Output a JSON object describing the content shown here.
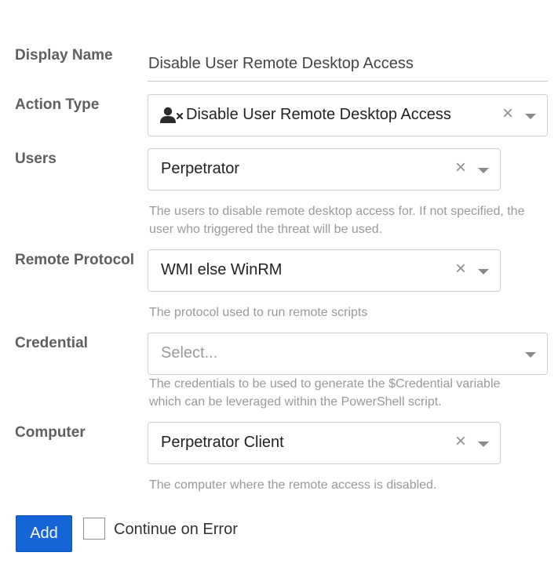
{
  "form": {
    "display_name": {
      "label": "Display Name",
      "value": "Disable User Remote Desktop Access"
    },
    "action_type": {
      "label": "Action Type",
      "value": "Disable User Remote Desktop Access",
      "icon": "user-x-icon",
      "clear": "×"
    },
    "users": {
      "label": "Users",
      "value": "Perpetrator",
      "clear": "×",
      "help": "The users to disable remote desktop access for. If not specified, the user who triggered the threat will be used."
    },
    "remote_protocol": {
      "label": "Remote Protocol",
      "value": "WMI else WinRM",
      "clear": "×",
      "help": "The protocol used to run remote scripts"
    },
    "credential": {
      "label": "Credential",
      "placeholder": "Select...",
      "help": "The credentials to be used to generate the $Credential variable which can be leveraged within the PowerShell script."
    },
    "computer": {
      "label": "Computer",
      "value": "Perpetrator Client",
      "clear": "×",
      "help": "The computer where the remote access is disabled."
    }
  },
  "actions": {
    "add_label": "Add",
    "continue_on_error_label": "Continue on Error",
    "continue_on_error_checked": false
  },
  "colors": {
    "primary_button": "#1565d8",
    "label_text": "#5f5f5f",
    "help_text": "#999999"
  }
}
